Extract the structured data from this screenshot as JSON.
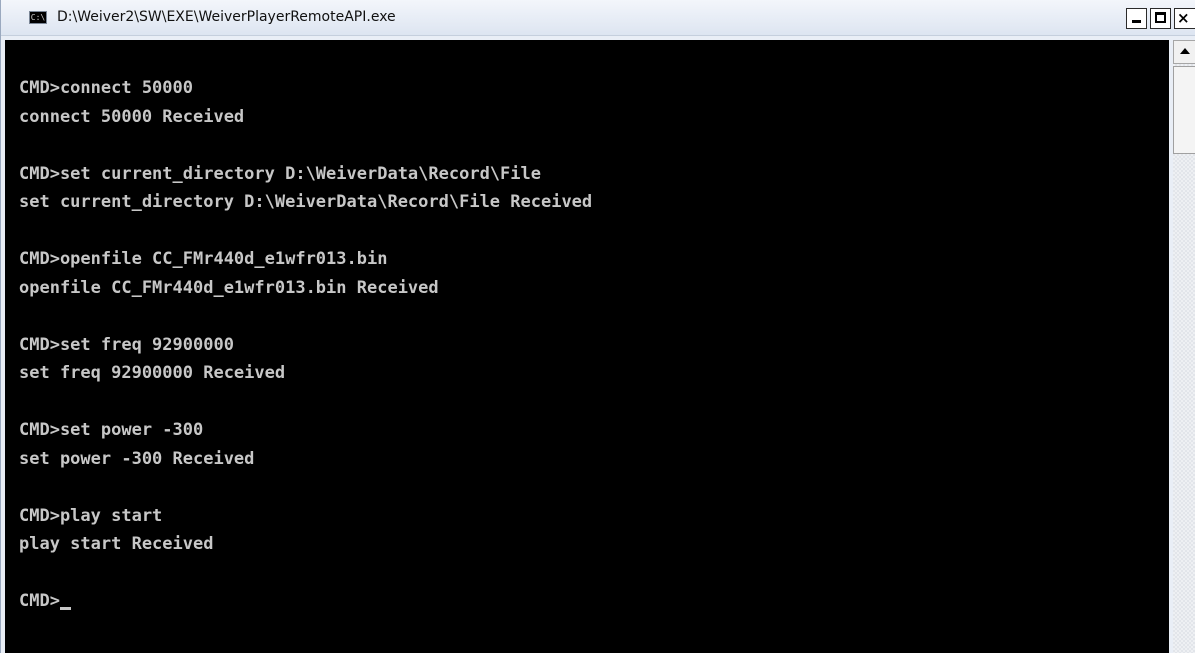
{
  "window": {
    "title": "D:\\Weiver2\\SW\\EXE\\WeiverPlayerRemoteAPI.exe",
    "icon": "console-icon",
    "icon_label": "C:\\",
    "buttons": {
      "minimize_icon": "minimize-icon",
      "maximize_icon": "maximize-icon",
      "close_icon": "close-icon",
      "close_glyph": "×"
    }
  },
  "console": {
    "background": "#000000",
    "foreground": "#c7c7c7",
    "lines": [
      "CMD>connect 50000",
      "connect 50000 Received",
      "",
      "CMD>set current_directory D:\\WeiverData\\Record\\File",
      "set current_directory D:\\WeiverData\\Record\\File Received",
      "",
      "CMD>openfile CC_FMr440d_e1wfr013.bin",
      "openfile CC_FMr440d_e1wfr013.bin Received",
      "",
      "CMD>set freq 92900000",
      "set freq 92900000 Received",
      "",
      "CMD>set power -300",
      "set power -300 Received",
      "",
      "CMD>play start",
      "play start Received",
      ""
    ],
    "prompt": "CMD>"
  },
  "scrollbar": {
    "up_icon": "scroll-up-arrow-icon"
  }
}
